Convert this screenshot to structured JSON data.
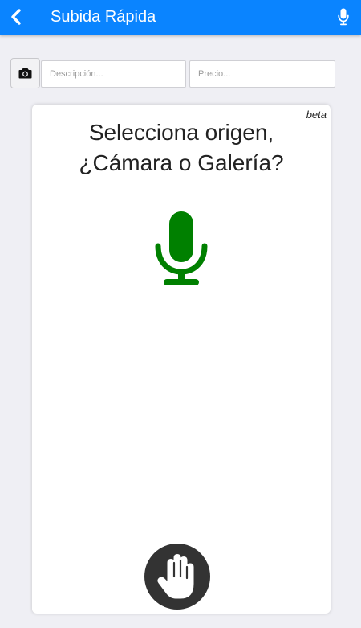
{
  "navbar": {
    "title": "Subida Rápida",
    "back_icon": "chevron-left-icon",
    "mic_icon": "microphone-icon",
    "color": "#0a84ff"
  },
  "form": {
    "camera_icon": "camera-icon",
    "description_placeholder": "Descripción...",
    "price_placeholder": "Precio..."
  },
  "card": {
    "badge": "beta",
    "prompt_line1": "Selecciona origen,",
    "prompt_line2": "¿Cámara o Galería?",
    "mic_icon": "microphone-icon",
    "mic_color": "#008000",
    "stop_icon": "hand-stop-icon"
  }
}
